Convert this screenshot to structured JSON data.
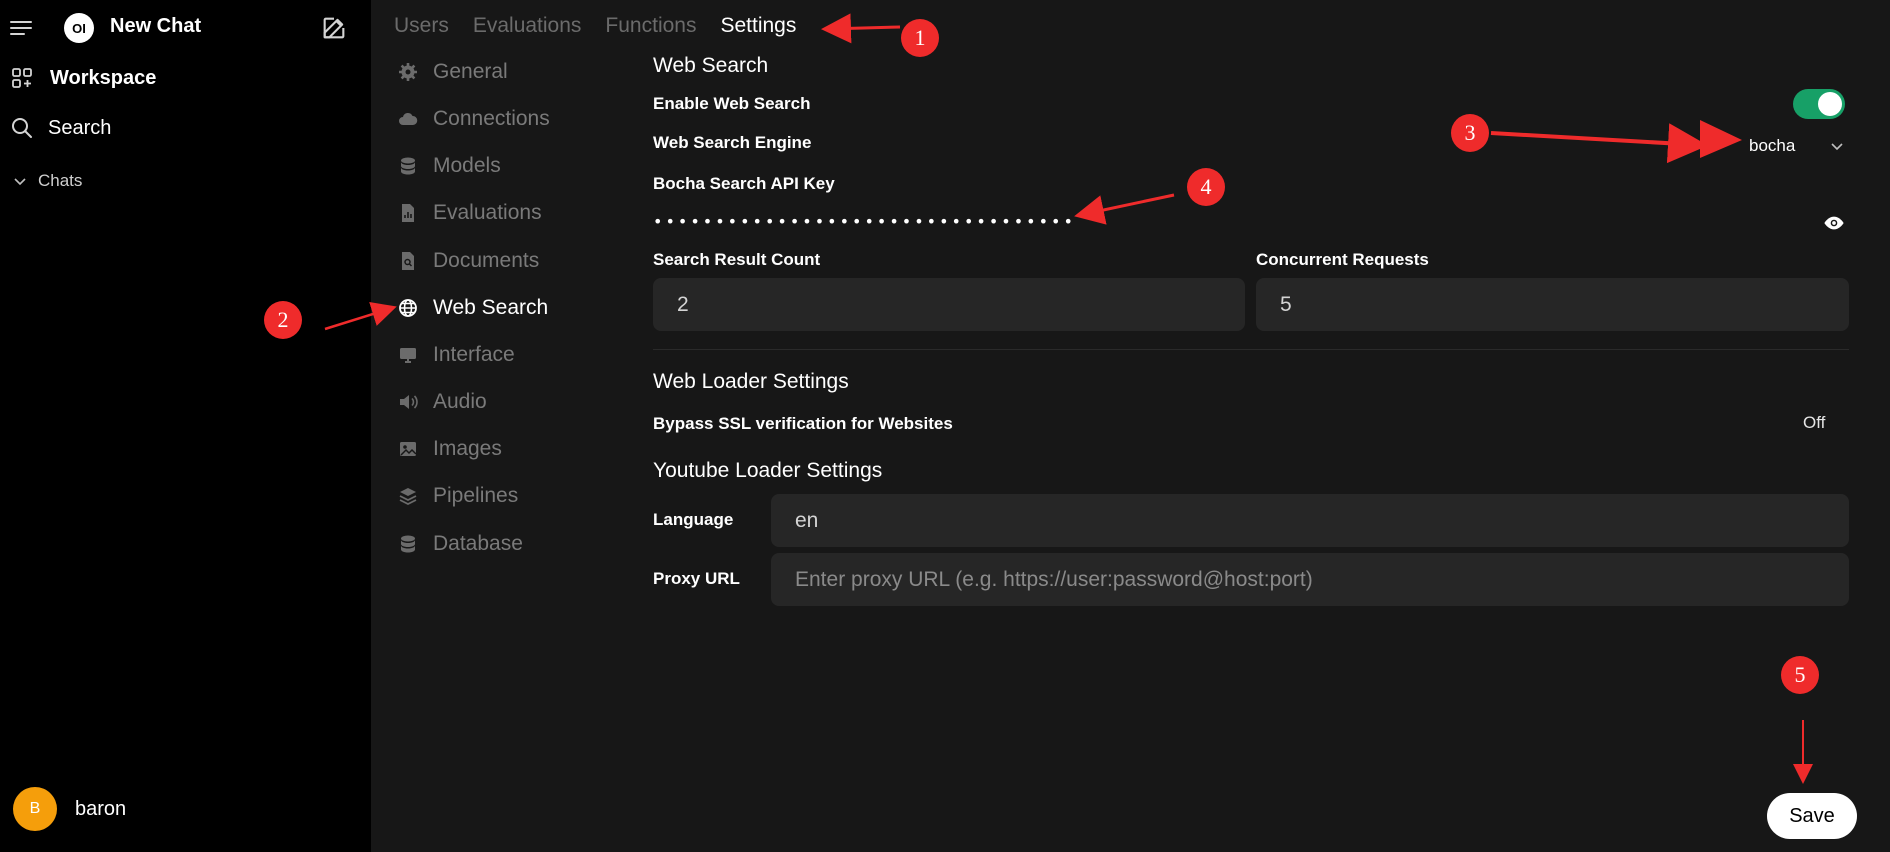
{
  "sidebar": {
    "new_chat": "New Chat",
    "logo_text": "OI",
    "workspace": "Workspace",
    "search": "Search",
    "chats": "Chats",
    "user": {
      "initial": "B",
      "name": "baron"
    }
  },
  "tabs": [
    {
      "label": "Users",
      "active": false
    },
    {
      "label": "Evaluations",
      "active": false
    },
    {
      "label": "Functions",
      "active": false
    },
    {
      "label": "Settings",
      "active": true
    }
  ],
  "settings_nav": [
    {
      "label": "General",
      "icon": "gear-icon",
      "active": false
    },
    {
      "label": "Connections",
      "icon": "cloud-icon",
      "active": false
    },
    {
      "label": "Models",
      "icon": "database-icon",
      "active": false
    },
    {
      "label": "Evaluations",
      "icon": "document-chart-icon",
      "active": false
    },
    {
      "label": "Documents",
      "icon": "document-search-icon",
      "active": false
    },
    {
      "label": "Web Search",
      "icon": "globe-icon",
      "active": true
    },
    {
      "label": "Interface",
      "icon": "monitor-icon",
      "active": false
    },
    {
      "label": "Audio",
      "icon": "speaker-icon",
      "active": false
    },
    {
      "label": "Images",
      "icon": "image-icon",
      "active": false
    },
    {
      "label": "Pipelines",
      "icon": "layers-icon",
      "active": false
    },
    {
      "label": "Database",
      "icon": "database-icon",
      "active": false
    }
  ],
  "web_search": {
    "title": "Web Search",
    "enable_label": "Enable Web Search",
    "enabled": true,
    "engine_label": "Web Search Engine",
    "engine_value": "bocha",
    "api_key_label": "Bocha Search API Key",
    "api_key_masked": "••••••••••••••••••••••••••••••••••",
    "result_count_label": "Search Result Count",
    "result_count_value": "2",
    "concurrent_label": "Concurrent Requests",
    "concurrent_value": "5"
  },
  "web_loader": {
    "title": "Web Loader Settings",
    "bypass_ssl_label": "Bypass SSL verification for Websites",
    "bypass_ssl_value": "Off"
  },
  "youtube_loader": {
    "title": "Youtube Loader Settings",
    "language_label": "Language",
    "language_value": "en",
    "proxy_label": "Proxy URL",
    "proxy_placeholder": "Enter proxy URL (e.g. https://user:password@host:port)"
  },
  "save_label": "Save",
  "annotations": [
    "1",
    "2",
    "3",
    "4",
    "5"
  ],
  "colors": {
    "accent_toggle": "#17a067",
    "annotation": "#ef2b2b",
    "avatar": "#f59e0b"
  }
}
